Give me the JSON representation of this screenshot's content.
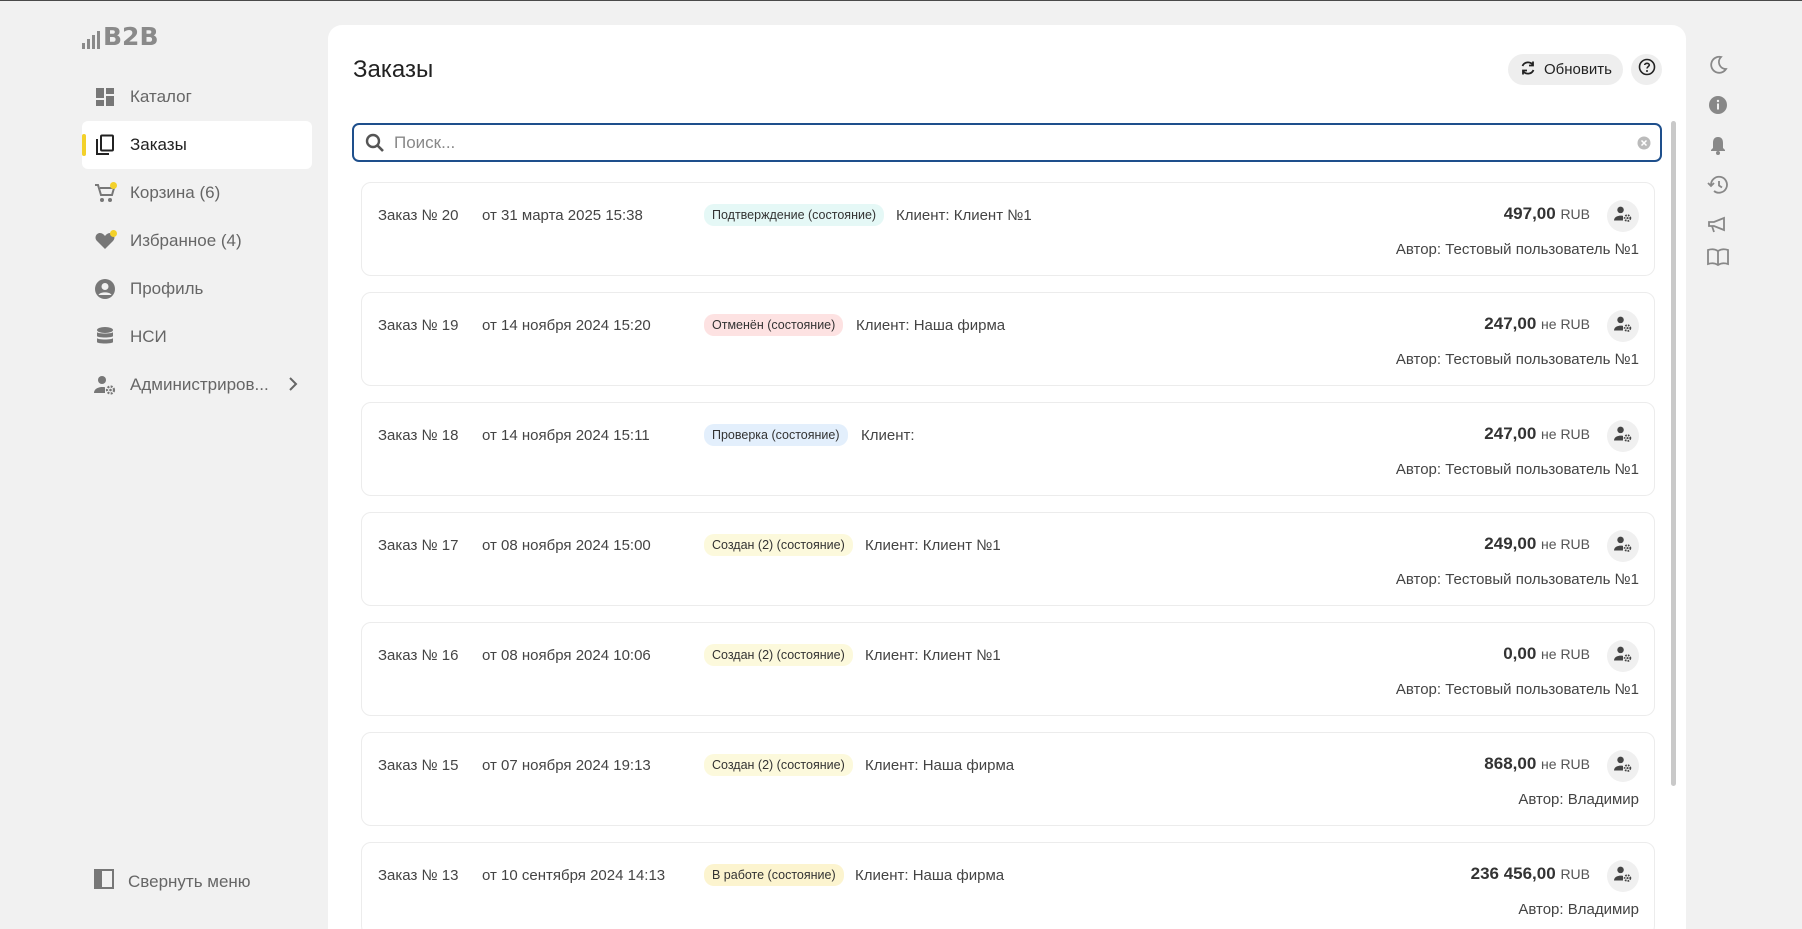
{
  "app": {
    "logo_text": "B2B"
  },
  "sidebar": {
    "items": [
      {
        "label": "Каталог",
        "icon": "dashboard-icon"
      },
      {
        "label": "Заказы",
        "icon": "copy-icon",
        "active": true
      },
      {
        "label": "Корзина (6)",
        "icon": "cart-icon"
      },
      {
        "label": "Избранное (4)",
        "icon": "heart-icon"
      },
      {
        "label": "Профиль",
        "icon": "account-circle-icon"
      },
      {
        "label": "НСИ",
        "icon": "database-icon"
      },
      {
        "label": "Администриров...",
        "icon": "user-gear-icon"
      }
    ],
    "collapse_label": "Свернуть меню"
  },
  "main": {
    "title": "Заказы",
    "refresh_label": "Обновить",
    "search_placeholder": "Поиск..."
  },
  "orders": [
    {
      "number": "Заказ № 20",
      "date": "от 31 марта 2025 15:38",
      "status": "Подтверждение (состояние)",
      "client": "Клиент: Клиент №1",
      "amount": "497,00",
      "currency": "RUB",
      "author": "Автор: Тестовый пользователь №1"
    },
    {
      "number": "Заказ № 19",
      "date": "от 14 ноября 2024 15:20",
      "status": "Отменён (состояние)",
      "client": "Клиент: Наша фирма",
      "amount": "247,00",
      "currency": "не RUB",
      "author": "Автор: Тестовый пользователь №1"
    },
    {
      "number": "Заказ № 18",
      "date": "от 14 ноября 2024 15:11",
      "status": "Проверка (состояние)",
      "client": "Клиент:",
      "amount": "247,00",
      "currency": "не RUB",
      "author": "Автор: Тестовый пользователь №1"
    },
    {
      "number": "Заказ № 17",
      "date": "от 08 ноября 2024 15:00",
      "status": "Создан (2) (состояние)",
      "client": "Клиент: Клиент №1",
      "amount": "249,00",
      "currency": "не RUB",
      "author": "Автор: Тестовый пользователь №1"
    },
    {
      "number": "Заказ № 16",
      "date": "от 08 ноября 2024 10:06",
      "status": "Создан (2) (состояние)",
      "client": "Клиент: Клиент №1",
      "amount": "0,00",
      "currency": "не RUB",
      "author": "Автор: Тестовый пользователь №1"
    },
    {
      "number": "Заказ № 15",
      "date": "от 07 ноября 2024 19:13",
      "status": "Создан (2) (состояние)",
      "client": "Клиент: Наша фирма",
      "amount": "868,00",
      "currency": "не RUB",
      "author": "Автор: Владимир"
    },
    {
      "number": "Заказ № 13",
      "date": "от 10 сентября 2024 14:13",
      "status": "В работе (состояние)",
      "client": "Клиент: Наша фирма",
      "amount": "236 456,00",
      "currency": "RUB",
      "author": "Автор: Владимир"
    }
  ],
  "rail_icons": [
    "moon-icon",
    "info-icon",
    "bell-icon",
    "history-icon",
    "megaphone-icon",
    "book-icon"
  ],
  "colors": {
    "accent": "#f3d12a",
    "search_border": "#1e4f8c",
    "background": "#f1f1f1"
  }
}
